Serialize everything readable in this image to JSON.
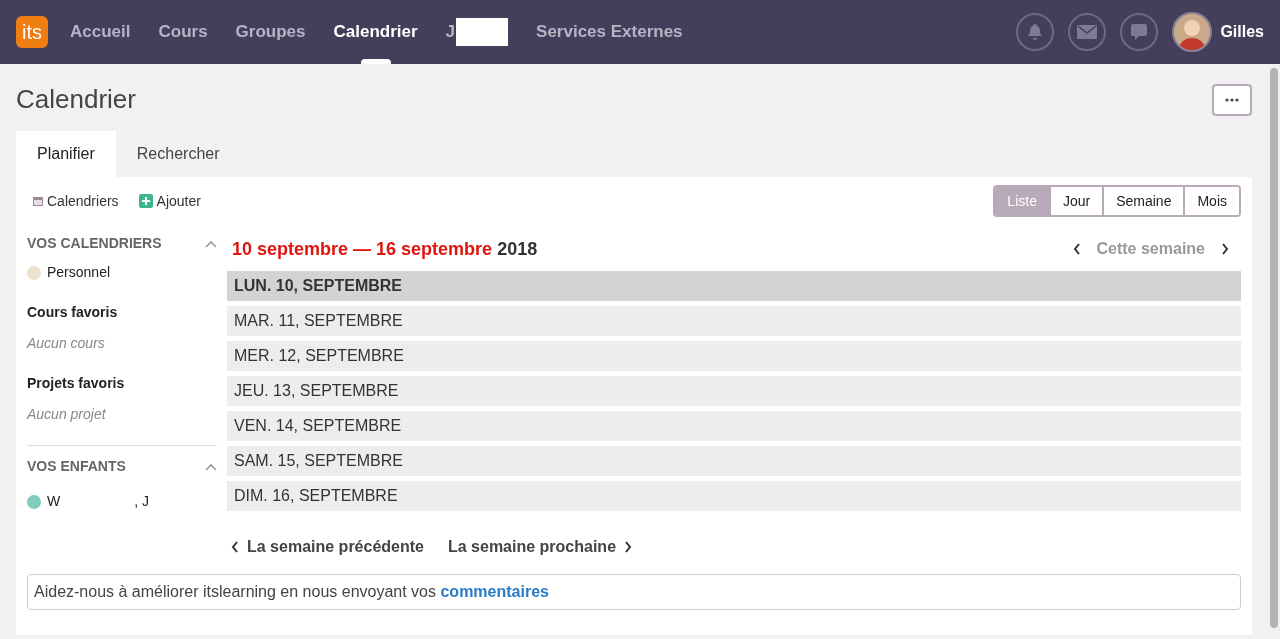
{
  "nav": {
    "logo": "its",
    "items": [
      {
        "label": "Accueil",
        "selected": false
      },
      {
        "label": "Cours",
        "selected": false
      },
      {
        "label": "Groupes",
        "selected": false
      },
      {
        "label": "Calendrier",
        "selected": true
      },
      {
        "label": "J",
        "selected": false,
        "redacted": true
      },
      {
        "label": "Services Externes",
        "selected": false
      }
    ],
    "user": "Gilles"
  },
  "page_title": "Calendrier",
  "tabs": [
    {
      "label": "Planifier",
      "selected": true
    },
    {
      "label": "Rechercher",
      "selected": false
    }
  ],
  "toolbar": {
    "calendars": "Calendriers",
    "add": "Ajouter"
  },
  "views": [
    {
      "label": "Liste",
      "selected": true
    },
    {
      "label": "Jour",
      "selected": false
    },
    {
      "label": "Semaine",
      "selected": false
    },
    {
      "label": "Mois",
      "selected": false
    }
  ],
  "sidebar": {
    "my_calendars": {
      "title": "VOS CALENDRIERS",
      "items": [
        {
          "label": "Personnel",
          "color": "#ede3cf"
        }
      ]
    },
    "fav_courses": {
      "title": "Cours favoris",
      "empty": "Aucun cours"
    },
    "fav_projects": {
      "title": "Projets favoris",
      "empty": "Aucun projet"
    },
    "children": {
      "title": "VOS ENFANTS",
      "items": [
        {
          "label": "W",
          "label_2": ", J",
          "color": "#7ecdbd"
        }
      ]
    }
  },
  "range": {
    "dates": "10 septembre — 16 septembre",
    "year": "2018",
    "this_week": "Cette semaine"
  },
  "days": [
    {
      "label": "LUN. 10, SEPTEMBRE",
      "selected": true
    },
    {
      "label": "MAR. 11, SEPTEMBRE",
      "selected": false
    },
    {
      "label": "MER. 12, SEPTEMBRE",
      "selected": false
    },
    {
      "label": "JEU. 13, SEPTEMBRE",
      "selected": false
    },
    {
      "label": "VEN. 14, SEPTEMBRE",
      "selected": false
    },
    {
      "label": "SAM. 15, SEPTEMBRE",
      "selected": false
    },
    {
      "label": "DIM. 16, SEPTEMBRE",
      "selected": false
    }
  ],
  "prev_week": "La semaine précédente",
  "next_week": "La semaine prochaine",
  "feedback": {
    "text": "Aidez-nous à améliorer itslearning en nous envoyant vos",
    "link": "commentaires"
  }
}
